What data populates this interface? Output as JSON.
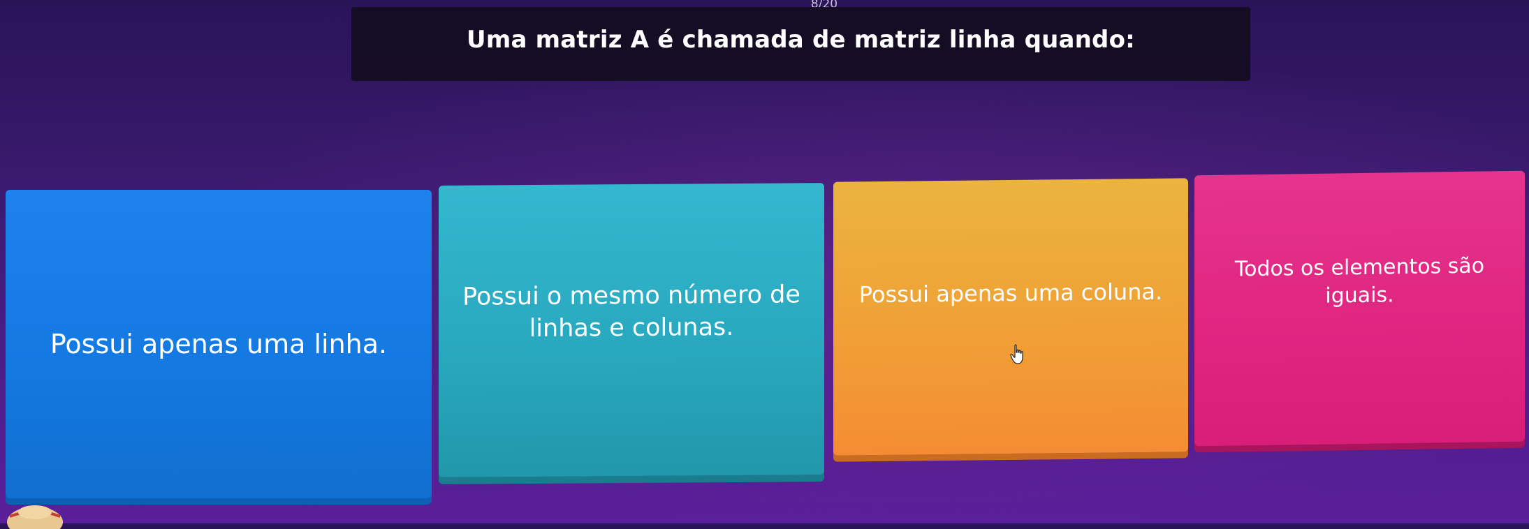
{
  "quiz": {
    "counter": "8/20",
    "question": "Uma matriz A é chamada de matriz linha quando:"
  },
  "answers": [
    {
      "label": "Possui apenas uma linha.",
      "color": "#1378e0"
    },
    {
      "label": "Possui o mesmo número de linhas e colunas.",
      "color": "#28a7bd"
    },
    {
      "label": "Possui apenas uma coluna.",
      "color": "#f0a036"
    },
    {
      "label": "Todos os elementos são iguais.",
      "color": "#df2580"
    }
  ],
  "cursor": {
    "icon": "hand-pointer-icon"
  },
  "player": {
    "icon": "player-avatar-icon"
  }
}
